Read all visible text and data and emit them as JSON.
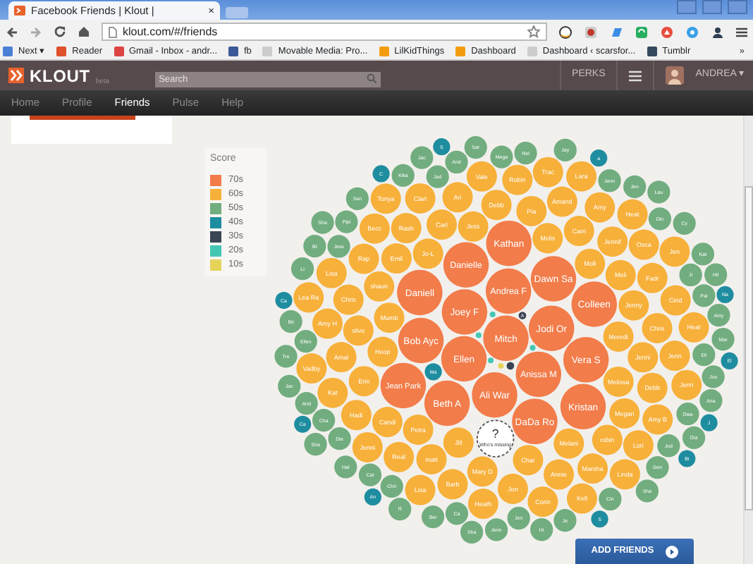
{
  "browser": {
    "tab_title": "Facebook Friends | Klout |",
    "tab_close": "×",
    "url": "klout.com/#/friends",
    "bookmarks": [
      {
        "label": "Next ▾"
      },
      {
        "label": "Reader"
      },
      {
        "label": "Gmail - Inbox - andr..."
      },
      {
        "label": "fb"
      },
      {
        "label": "Movable Media: Pro..."
      },
      {
        "label": "LilKidThings"
      },
      {
        "label": "Dashboard"
      },
      {
        "label": "Dashboard ‹ scarsfor..."
      },
      {
        "label": "Tumblr"
      }
    ],
    "more": "»"
  },
  "header": {
    "logo": "KLOUT",
    "logo_tag": "beta",
    "search": {
      "placeholder": "Search"
    },
    "perks": "PERKS",
    "user": "ANDREA",
    "caret": "▾"
  },
  "nav": [
    {
      "label": "Home",
      "selected": false
    },
    {
      "label": "Profile",
      "selected": false
    },
    {
      "label": "Friends",
      "selected": true
    },
    {
      "label": "Pulse",
      "selected": false
    },
    {
      "label": "Help",
      "selected": false
    }
  ],
  "legend": {
    "title": "Score",
    "items": [
      {
        "label": "70s",
        "color": "#f27c4a"
      },
      {
        "label": "60s",
        "color": "#f7b03a"
      },
      {
        "label": "50s",
        "color": "#72ad7f"
      },
      {
        "label": "40s",
        "color": "#1f8da0"
      },
      {
        "label": "30s",
        "color": "#3a4452"
      },
      {
        "label": "20s",
        "color": "#44c7b3"
      },
      {
        "label": "10s",
        "color": "#e5d35a"
      }
    ]
  },
  "missing": {
    "mark": "?",
    "label": "Who's missing"
  },
  "bubbles": [
    {
      "name": "Mitch",
      "color": "#f27c4a"
    },
    {
      "name": "Meredi",
      "color": "#f7b03a"
    },
    {
      "name": "Mumb",
      "color": "#f7b03a"
    },
    {
      "name": "Moll",
      "color": "#f7b03a"
    },
    {
      "name": "Ma",
      "color": "#1f8da0"
    },
    {
      "name": "Jess",
      "color": "#72ad7f"
    },
    {
      "name": "Jad",
      "color": "#72ad7f"
    },
    {
      "name": "Melis",
      "color": "#f7b03a"
    },
    {
      "name": "Melissa",
      "color": "#f7b03a"
    },
    {
      "name": "Hoop",
      "color": "#f7b03a"
    },
    {
      "name": "Na",
      "color": "#1f8da0"
    },
    {
      "name": "Jo-L",
      "color": "#f7b03a"
    },
    {
      "name": "Ji",
      "color": "#72ad7f"
    },
    {
      "name": "Jill",
      "color": "#f7b03a"
    },
    {
      "name": "Jess",
      "color": "#f7b03a"
    },
    {
      "name": "Jenny",
      "color": "#f7b03a"
    },
    {
      "name": "Meli",
      "color": "#f7b03a"
    },
    {
      "name": "Melani",
      "color": "#f7b03a"
    },
    {
      "name": "Jodi Or",
      "color": "#f27c4a"
    },
    {
      "name": "Ellen",
      "color": "#f27c4a"
    },
    {
      "name": "Petra",
      "color": "#f7b03a"
    },
    {
      "name": "Eli",
      "color": "#72ad7f"
    },
    {
      "name": "Ellen",
      "color": "#72ad7f"
    },
    {
      "name": "El",
      "color": "#1f8da0"
    },
    {
      "name": "Dwa",
      "color": "#72ad7f"
    },
    {
      "name": "Die",
      "color": "#72ad7f"
    },
    {
      "name": "Jenni",
      "color": "#f7b03a"
    },
    {
      "name": "shaun",
      "color": "#f7b03a"
    },
    {
      "name": "Char",
      "color": "#f7b03a"
    },
    {
      "name": "Pal",
      "color": "#72ad7f"
    },
    {
      "name": "Jod",
      "color": "#72ad7f"
    },
    {
      "name": "Emil",
      "color": "#f7b03a"
    },
    {
      "name": "Chri",
      "color": "#72ad7f"
    },
    {
      "name": "Cha",
      "color": "#72ad7f"
    },
    {
      "name": "Carri",
      "color": "#f7b03a"
    },
    {
      "name": "Carl",
      "color": "#f7b03a"
    },
    {
      "name": "Din",
      "color": "#72ad7f"
    },
    {
      "name": "Jen",
      "color": "#72ad7f"
    },
    {
      "name": "Megan",
      "color": "#f7b03a"
    },
    {
      "name": "silvo",
      "color": "#f7b03a"
    },
    {
      "name": "Pia",
      "color": "#f7b03a"
    },
    {
      "name": "J",
      "color": "#1f8da0"
    },
    {
      "name": "Ca",
      "color": "#72ad7f"
    },
    {
      "name": "Cat",
      "color": "#72ad7f"
    },
    {
      "name": "Pipi",
      "color": "#72ad7f"
    },
    {
      "name": "Joey F",
      "color": "#f27c4a"
    },
    {
      "name": "Erin",
      "color": "#f7b03a"
    },
    {
      "name": "Chris",
      "color": "#f7b03a"
    },
    {
      "name": "Anissa M",
      "color": "#f27c4a"
    },
    {
      "name": "An",
      "color": "#1f8da0"
    },
    {
      "name": "And",
      "color": "#72ad7f"
    },
    {
      "name": "Andrea F",
      "color": "#f27c4a"
    },
    {
      "name": "Ca",
      "color": "#1f8da0"
    },
    {
      "name": "Candi",
      "color": "#f7b03a"
    },
    {
      "name": "Debb",
      "color": "#f7b03a"
    },
    {
      "name": "Jennif",
      "color": "#f7b03a"
    },
    {
      "name": "Mega",
      "color": "#72ad7f"
    },
    {
      "name": "robin",
      "color": "#f7b03a"
    },
    {
      "name": "Mary D",
      "color": "#f7b03a"
    },
    {
      "name": "Debb",
      "color": "#f7b03a"
    },
    {
      "name": "Jenn",
      "color": "#72ad7f"
    },
    {
      "name": "matt",
      "color": "#f7b03a"
    },
    {
      "name": "Rash",
      "color": "#f7b03a"
    },
    {
      "name": "Jos",
      "color": "#72ad7f"
    },
    {
      "name": "Fadr",
      "color": "#f7b03a"
    },
    {
      "name": "Chris",
      "color": "#f7b03a"
    },
    {
      "name": "Annie",
      "color": "#f7b03a"
    },
    {
      "name": "Amal",
      "color": "#f7b03a"
    },
    {
      "name": "Amand",
      "color": "#f7b03a"
    },
    {
      "name": "Rap",
      "color": "#f7b03a"
    },
    {
      "name": "Gen",
      "color": "#72ad7f"
    },
    {
      "name": "Cin",
      "color": "#72ad7f"
    },
    {
      "name": "A",
      "color": "#3a4452"
    },
    {
      "name": "Ari",
      "color": "#f7b03a"
    },
    {
      "name": "Ali War",
      "color": "#f27c4a"
    },
    {
      "name": "And",
      "color": "#72ad7f"
    },
    {
      "name": "Ca",
      "color": "#1f8da0"
    },
    {
      "name": "Jenn",
      "color": "#f7b03a"
    },
    {
      "name": "Marsha",
      "color": "#f7b03a"
    },
    {
      "name": "Kika",
      "color": "#72ad7f"
    },
    {
      "name": "Jon",
      "color": "#f7b03a"
    },
    {
      "name": "Real",
      "color": "#f7b03a"
    },
    {
      "name": "Rel",
      "color": "#72ad7f"
    },
    {
      "name": "Hadi",
      "color": "#f7b03a"
    },
    {
      "name": "Osca",
      "color": "#f7b03a"
    },
    {
      "name": "Cind",
      "color": "#f7b03a"
    },
    {
      "name": "Barb",
      "color": "#f7b03a"
    },
    {
      "name": "Amy",
      "color": "#f7b03a"
    },
    {
      "name": "Amy",
      "color": "#72ad7f"
    },
    {
      "name": "Bri",
      "color": "#72ad7f"
    },
    {
      "name": "Dawn Sa",
      "color": "#f27c4a"
    },
    {
      "name": "Jen",
      "color": "#72ad7f"
    },
    {
      "name": "Mar",
      "color": "#72ad7f"
    },
    {
      "name": "C",
      "color": "#1f8da0"
    },
    {
      "name": "a",
      "color": "#1f8da0"
    },
    {
      "name": "Amy B",
      "color": "#f7b03a"
    },
    {
      "name": "Amy H",
      "color": "#f7b03a"
    },
    {
      "name": "Ana",
      "color": "#72ad7f"
    },
    {
      "name": "Lori",
      "color": "#f7b03a"
    },
    {
      "name": "Vera S",
      "color": "#f27c4a"
    },
    {
      "name": "Je",
      "color": "#72ad7f"
    },
    {
      "name": "Becc",
      "color": "#f7b03a"
    },
    {
      "name": "Ber",
      "color": "#72ad7f"
    },
    {
      "name": "Hal",
      "color": "#72ad7f"
    },
    {
      "name": "Clari",
      "color": "#f7b03a"
    },
    {
      "name": "Robin",
      "color": "#f7b03a"
    },
    {
      "name": "Kat",
      "color": "#f7b03a"
    },
    {
      "name": "Bi",
      "color": "#1f8da0"
    },
    {
      "name": "Bob Ayc",
      "color": "#f27c4a"
    },
    {
      "name": "Danielle",
      "color": "#f27c4a"
    },
    {
      "name": "Jenni",
      "color": "#f7b03a"
    },
    {
      "name": "Li",
      "color": "#72ad7f"
    },
    {
      "name": "Vale",
      "color": "#f7b03a"
    },
    {
      "name": "Bt",
      "color": "#72ad7f"
    },
    {
      "name": "Heat",
      "color": "#f7b03a"
    },
    {
      "name": "San",
      "color": "#72ad7f"
    },
    {
      "name": "Kat",
      "color": "#72ad7f"
    },
    {
      "name": "Beth A",
      "color": "#f27c4a"
    },
    {
      "name": "Colleen",
      "color": "#f27c4a"
    },
    {
      "name": "DaDa Ro",
      "color": "#f27c4a"
    },
    {
      "name": "Dia",
      "color": "#72ad7f"
    },
    {
      "name": "Daniell",
      "color": "#f27c4a"
    },
    {
      "name": "Jenn",
      "color": "#72ad7f"
    },
    {
      "name": "Jenn",
      "color": "#f7b03a"
    },
    {
      "name": "Lisa",
      "color": "#f7b03a"
    },
    {
      "name": "Tre",
      "color": "#72ad7f"
    },
    {
      "name": "Sar",
      "color": "#72ad7f"
    },
    {
      "name": "Kathan",
      "color": "#f27c4a"
    },
    {
      "name": "Heat",
      "color": "#f7b03a"
    },
    {
      "name": "Conn",
      "color": "#f7b03a"
    },
    {
      "name": "Cy",
      "color": "#72ad7f"
    },
    {
      "name": "Heath",
      "color": "#f7b03a"
    },
    {
      "name": "Hil",
      "color": "#72ad7f"
    },
    {
      "name": "Hi",
      "color": "#72ad7f"
    },
    {
      "name": "R",
      "color": "#72ad7f"
    },
    {
      "name": "Jac",
      "color": "#72ad7f"
    },
    {
      "name": "Jac",
      "color": "#72ad7f"
    },
    {
      "name": "Jay",
      "color": "#72ad7f"
    },
    {
      "name": "Lisa",
      "color": "#f7b03a"
    },
    {
      "name": "Trac",
      "color": "#f7b03a"
    },
    {
      "name": "Jen",
      "color": "#f7b03a"
    },
    {
      "name": "Linda",
      "color": "#f7b03a"
    },
    {
      "name": "Sha",
      "color": "#72ad7f"
    },
    {
      "name": "Vadby",
      "color": "#f7b03a"
    },
    {
      "name": "Kristan",
      "color": "#f27c4a"
    },
    {
      "name": "Kell",
      "color": "#f7b03a"
    },
    {
      "name": "Sha",
      "color": "#72ad7f"
    },
    {
      "name": "Sha",
      "color": "#72ad7f"
    },
    {
      "name": "S",
      "color": "#1f8da0"
    },
    {
      "name": "S",
      "color": "#1f8da0"
    },
    {
      "name": "Sha",
      "color": "#72ad7f"
    },
    {
      "name": "Jean Park",
      "color": "#f27c4a"
    },
    {
      "name": "Tonya",
      "color": "#f7b03a"
    },
    {
      "name": "Lara",
      "color": "#f7b03a"
    },
    {
      "name": "Lea Ra",
      "color": "#f7b03a"
    },
    {
      "name": "Lau",
      "color": "#72ad7f"
    },
    {
      "color": "#44c7b3"
    },
    {
      "color": "#44c7b3"
    },
    {
      "color": "#44c7b3"
    },
    {
      "color": "#44c7b3"
    },
    {
      "color": "#3a4452"
    },
    {
      "color": "#e5d35a"
    }
  ],
  "add_friends": "ADD FRIENDS"
}
